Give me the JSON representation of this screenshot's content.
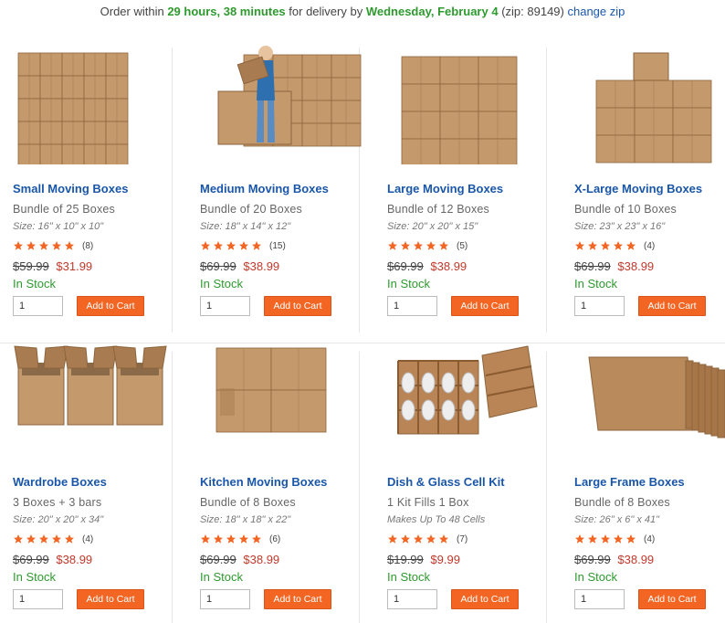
{
  "banner": {
    "prefix": "Order within",
    "time": "29 hours, 38 minutes",
    "middle": "for delivery by",
    "date": "Wednesday, February 4",
    "zip_text": "(zip: 89149)",
    "change_zip": "change zip"
  },
  "colors": {
    "link_blue": "#1a56a8",
    "in_stock_green": "#2e9a2e",
    "sale_red": "#c0392b",
    "cart_orange": "#f26522",
    "star_orange": "#f26522"
  },
  "products": [
    {
      "name": "Small Moving Boxes",
      "sub": "Bundle of 25 Boxes",
      "size": "Size: 16\" x 10\" x 10\"",
      "stars": 5,
      "reviews": "(8)",
      "old_price": "$59.99",
      "price": "$31.99",
      "stock": "In Stock",
      "qty": "1",
      "cart": "Add to Cart",
      "image": "stacked-small-boxes"
    },
    {
      "name": "Medium Moving Boxes",
      "sub": "Bundle of 20 Boxes",
      "size": "Size: 18\" x 14\" x 12\"",
      "stars": 5,
      "reviews": "(15)",
      "old_price": "$69.99",
      "price": "$38.99",
      "stock": "In Stock",
      "qty": "1",
      "cart": "Add to Cart",
      "image": "person-carrying-box"
    },
    {
      "name": "Large Moving Boxes",
      "sub": "Bundle of 12 Boxes",
      "size": "Size: 20\" x 20\" x 15\"",
      "stars": 5,
      "reviews": "(5)",
      "old_price": "$69.99",
      "price": "$38.99",
      "stock": "In Stock",
      "qty": "1",
      "cart": "Add to Cart",
      "image": "stacked-large-boxes"
    },
    {
      "name": "X-Large Moving Boxes",
      "sub": "Bundle of 10 Boxes",
      "size": "Size: 23\" x 23\" x 16\"",
      "stars": 5,
      "reviews": "(4)",
      "old_price": "$69.99",
      "price": "$38.99",
      "stock": "In Stock",
      "qty": "1",
      "cart": "Add to Cart",
      "image": "stacked-xlarge-boxes"
    },
    {
      "name": "Wardrobe Boxes",
      "sub": "3 Boxes + 3 bars",
      "size": "Size: 20\" x 20\" x 34\"",
      "stars": 5,
      "reviews": "(4)",
      "old_price": "$69.99",
      "price": "$38.99",
      "stock": "In Stock",
      "qty": "1",
      "cart": "Add to Cart",
      "image": "open-wardrobe-boxes"
    },
    {
      "name": "Kitchen Moving Boxes",
      "sub": "Bundle of 8 Boxes",
      "size": "Size: 18\" x 18\" x 22\"",
      "stars": 5,
      "reviews": "(6)",
      "old_price": "$69.99",
      "price": "$38.99",
      "stock": "In Stock",
      "qty": "1",
      "cart": "Add to Cart",
      "image": "stacked-kitchen-boxes"
    },
    {
      "name": "Dish & Glass Cell Kit",
      "sub": "1 Kit Fills 1 Box",
      "size": "Makes Up To 48 Cells",
      "stars": 5,
      "reviews": "(7)",
      "old_price": "$19.99",
      "price": "$9.99",
      "stock": "In Stock",
      "qty": "1",
      "cart": "Add to Cart",
      "image": "cell-divider-kit"
    },
    {
      "name": "Large Frame Boxes",
      "sub": "Bundle of 8 Boxes",
      "size": "Size: 26\" x 6\" x 41\"",
      "stars": 5,
      "reviews": "(4)",
      "old_price": "$69.99",
      "price": "$38.99",
      "stock": "In Stock",
      "qty": "1",
      "cart": "Add to Cart",
      "image": "flat-frame-boxes"
    }
  ]
}
